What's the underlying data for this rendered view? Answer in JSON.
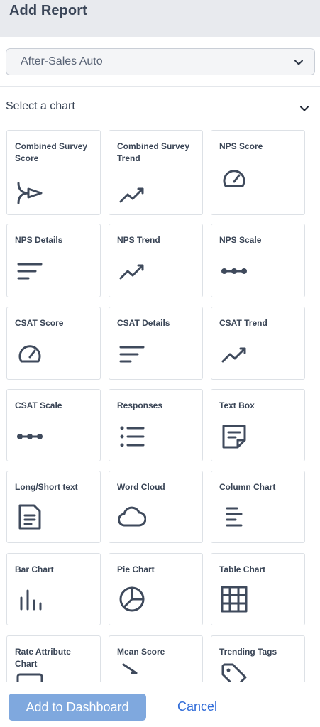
{
  "header": {
    "title": "Add Report"
  },
  "survey_select": {
    "value": "After-Sales Auto",
    "icon": "chevron-down-icon"
  },
  "section": {
    "title": "Select a chart",
    "icon": "chevron-down-icon"
  },
  "charts": [
    {
      "label": "Combined Survey Score",
      "icon": "merge-arrow-icon"
    },
    {
      "label": "Combined Survey Trend",
      "icon": "trend-icon"
    },
    {
      "label": "NPS Score",
      "icon": "gauge-icon"
    },
    {
      "label": "NPS Details",
      "icon": "details-icon"
    },
    {
      "label": "NPS Trend",
      "icon": "trend-icon"
    },
    {
      "label": "NPS Scale",
      "icon": "scale-icon"
    },
    {
      "label": "CSAT Score",
      "icon": "gauge-icon"
    },
    {
      "label": "CSAT Details",
      "icon": "details-icon"
    },
    {
      "label": "CSAT Trend",
      "icon": "trend-icon"
    },
    {
      "label": "CSAT Scale",
      "icon": "scale-icon"
    },
    {
      "label": "Responses",
      "icon": "list-icon"
    },
    {
      "label": "Text Box",
      "icon": "note-icon"
    },
    {
      "label": "Long/Short text",
      "icon": "document-icon"
    },
    {
      "label": "Word Cloud",
      "icon": "cloud-icon"
    },
    {
      "label": "Column Chart",
      "icon": "column-chart-icon"
    },
    {
      "label": "Bar Chart",
      "icon": "bar-chart-icon"
    },
    {
      "label": "Pie Chart",
      "icon": "pie-chart-icon"
    },
    {
      "label": "Table Chart",
      "icon": "table-icon"
    },
    {
      "label": "Rate Attribute Chart",
      "icon": "rate-attribute-icon"
    },
    {
      "label": "Mean Score",
      "icon": "sigma-icon"
    },
    {
      "label": "Trending Tags",
      "icon": "tag-icon"
    }
  ],
  "footer": {
    "add_label": "Add to Dashboard",
    "cancel_label": "Cancel"
  },
  "colors": {
    "icon": "#3f4a5c",
    "primary_button": "#7fa8de",
    "link": "#2f6bd8",
    "header_bg": "#e8eaee"
  }
}
